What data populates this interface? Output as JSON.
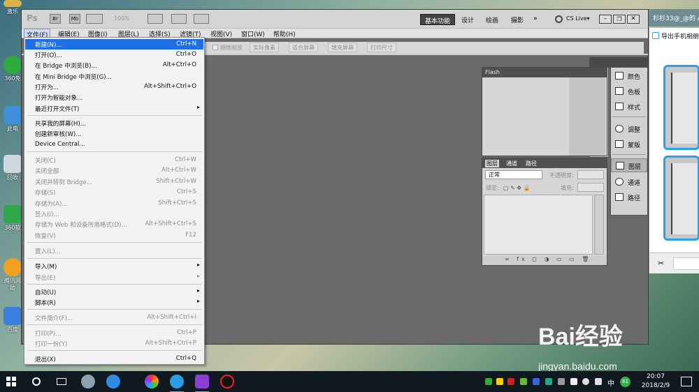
{
  "desktop": {
    "icons": [
      {
        "label": "激乐"
      },
      {
        "label": "360免"
      },
      {
        "label": "此电"
      },
      {
        "label": "回收"
      },
      {
        "label": "360软"
      },
      {
        "label": "腾讯网 助"
      },
      {
        "label": "百度"
      }
    ]
  },
  "right_window": {
    "title": "杉杉33@_@的 A",
    "heading": "导出手机相册"
  },
  "photoshop": {
    "logo": "Ps",
    "top_buttons": [
      "Br",
      "Mb"
    ],
    "zoom": "100%",
    "workspaces": [
      "基本功能",
      "设计",
      "绘画",
      "摄影"
    ],
    "more": "»",
    "cs_live": "CS Live▾",
    "menubar": [
      "文件(F)",
      "编辑(E)",
      "图像(I)",
      "图层(L)",
      "选择(S)",
      "滤镜(T)",
      "视图(V)",
      "窗口(W)",
      "帮助(H)"
    ],
    "options": [
      "细微缩放",
      "实际像素",
      "适合屏幕",
      "填充屏幕",
      "打印尺寸"
    ],
    "file_menu": [
      {
        "label": "新建(N)...",
        "shortcut": "Ctrl+N",
        "state": "highlighted"
      },
      {
        "label": "打开(O)...",
        "shortcut": "Ctrl+O",
        "state": "enabled"
      },
      {
        "label": "在 Bridge 中浏览(B)...",
        "shortcut": "Alt+Ctrl+O",
        "state": "enabled"
      },
      {
        "label": "在 Mini Bridge 中浏览(G)...",
        "shortcut": "",
        "state": "enabled"
      },
      {
        "label": "打开为...",
        "shortcut": "Alt+Shift+Ctrl+O",
        "state": "enabled"
      },
      {
        "label": "打开为智能对象...",
        "shortcut": "",
        "state": "enabled"
      },
      {
        "label": "最近打开文件(T)",
        "shortcut": "",
        "state": "enabled",
        "submenu": true
      },
      {
        "label": "共享我的屏幕(H)...",
        "shortcut": "",
        "state": "enabled"
      },
      {
        "label": "创建新审核(W)...",
        "shortcut": "",
        "state": "enabled"
      },
      {
        "label": "Device Central...",
        "shortcut": "",
        "state": "enabled"
      },
      {
        "label": "关闭(C)",
        "shortcut": "Ctrl+W",
        "state": "disabled"
      },
      {
        "label": "关闭全部",
        "shortcut": "Alt+Ctrl+W",
        "state": "disabled"
      },
      {
        "label": "关闭并转到 Bridge...",
        "shortcut": "Shift+Ctrl+W",
        "state": "disabled"
      },
      {
        "label": "存储(S)",
        "shortcut": "Ctrl+S",
        "state": "disabled"
      },
      {
        "label": "存储为(A)...",
        "shortcut": "Shift+Ctrl+S",
        "state": "disabled"
      },
      {
        "label": "签入(I)...",
        "shortcut": "",
        "state": "disabled"
      },
      {
        "label": "存储为 Web 和设备所用格式(D)...",
        "shortcut": "Alt+Shift+Ctrl+S",
        "state": "disabled"
      },
      {
        "label": "恢复(V)",
        "shortcut": "F12",
        "state": "disabled"
      },
      {
        "label": "置入(L)...",
        "shortcut": "",
        "state": "disabled"
      },
      {
        "label": "导入(M)",
        "shortcut": "",
        "state": "enabled",
        "submenu": true
      },
      {
        "label": "导出(E)",
        "shortcut": "",
        "state": "disabled",
        "submenu": true
      },
      {
        "label": "自动(U)",
        "shortcut": "",
        "state": "enabled",
        "submenu": true
      },
      {
        "label": "脚本(R)",
        "shortcut": "",
        "state": "enabled",
        "submenu": true
      },
      {
        "label": "文件简介(F)...",
        "shortcut": "Alt+Shift+Ctrl+I",
        "state": "disabled"
      },
      {
        "label": "打印(P)...",
        "shortcut": "Ctrl+P",
        "state": "disabled"
      },
      {
        "label": "打印一份(Y)",
        "shortcut": "Alt+Shift+Ctrl+P",
        "state": "disabled"
      },
      {
        "label": "退出(X)",
        "shortcut": "Ctrl+Q",
        "state": "enabled"
      }
    ],
    "flash_panel": {
      "title": "Flash"
    },
    "layers_panel": {
      "tabs": [
        "图层",
        "通道",
        "路径"
      ],
      "blend_mode": "正常",
      "opacity_label": "不透明度:",
      "lock_label": "锁定:",
      "fill_label": "填充:"
    },
    "dock": {
      "group1": [
        "颜色",
        "色板",
        "样式"
      ],
      "group2": [
        "调整",
        "蒙版"
      ],
      "group3": [
        "图层",
        "通道",
        "路径"
      ]
    }
  },
  "taskbar": {
    "ime": "中",
    "badge": "61",
    "time": "20:07",
    "date": "2018/2/9"
  },
  "watermark": {
    "brand": "Bai经验",
    "url": "jingyan.baidu.com"
  },
  "colors": {
    "menu_highlight": "#1f6fe3",
    "accent_blue": "#2aa0e5",
    "ps_workspace": "#6a6a6a",
    "taskbar": "#101820"
  }
}
